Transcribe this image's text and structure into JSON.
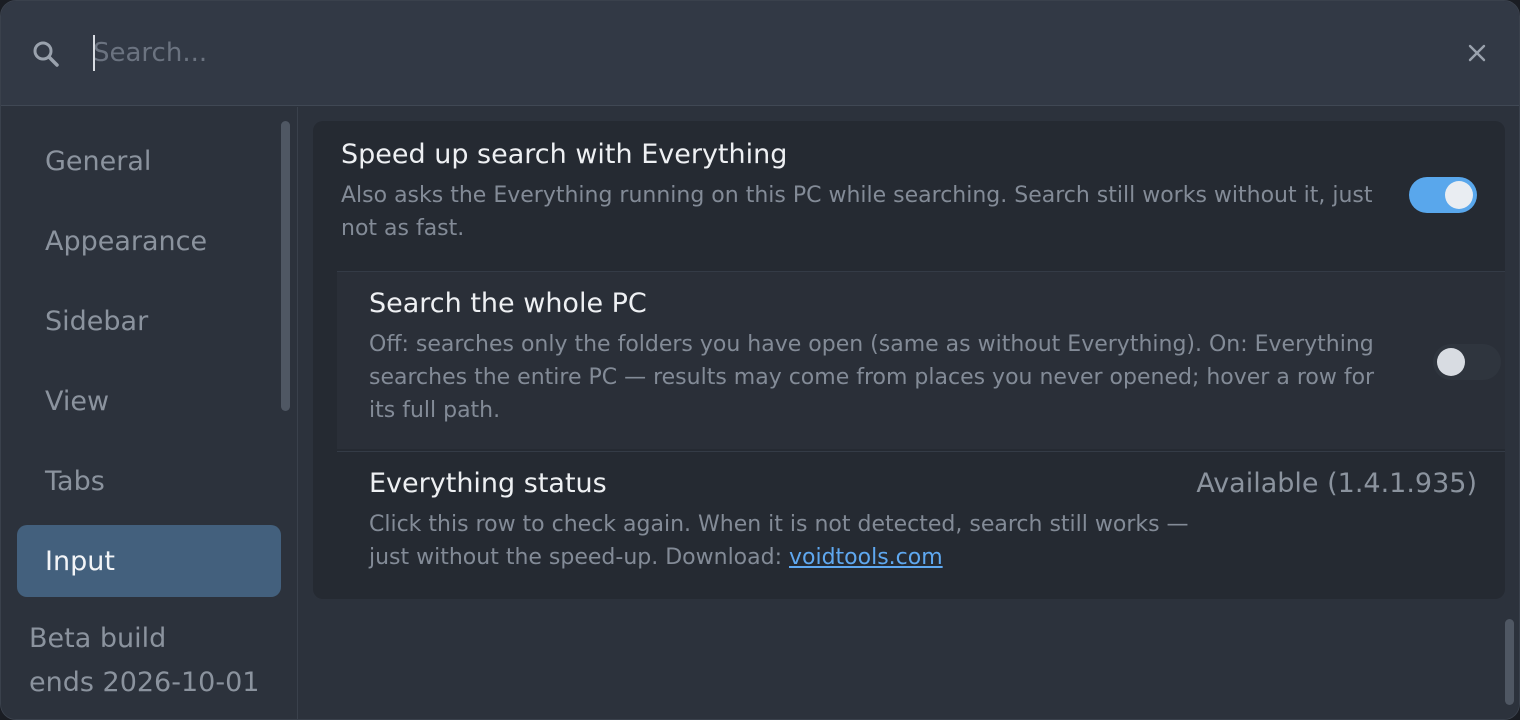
{
  "search": {
    "placeholder": "Search...",
    "value": ""
  },
  "sidebar": {
    "items": [
      {
        "label": "General",
        "active": false
      },
      {
        "label": "Appearance",
        "active": false
      },
      {
        "label": "Sidebar",
        "active": false
      },
      {
        "label": "View",
        "active": false
      },
      {
        "label": "Tabs",
        "active": false
      },
      {
        "label": "Input",
        "active": true
      }
    ],
    "beta_line1": "Beta build",
    "beta_line2": "ends 2026-10-01"
  },
  "settings": {
    "speed_up": {
      "title": "Speed up search with Everything",
      "description": "Also asks the Everything running on this PC while searching. Search still works without it, just not as fast.",
      "enabled": true
    },
    "whole_pc": {
      "title": "Search the whole PC",
      "description": "Off: searches only the folders you have open (same as without Everything). On: Everything searches the entire PC — results may come from places you never opened; hover a row for its full path.",
      "enabled": false
    },
    "status": {
      "title": "Everything status",
      "description_prefix": "Click this row to check again. When it is not detected, search still works — just without the speed-up. Download: ",
      "link_text": "voidtools.com",
      "value": "Available (1.4.1.935)"
    }
  },
  "colors": {
    "accent": "#59a7ec",
    "active_nav": "#43607d",
    "link": "#5fa8f0"
  }
}
